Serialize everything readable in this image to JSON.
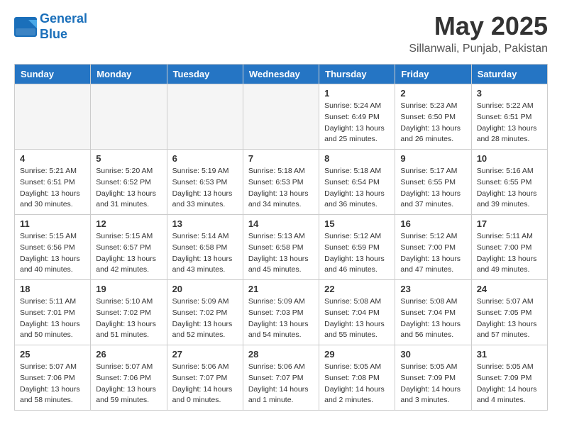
{
  "header": {
    "logo_line1": "General",
    "logo_line2": "Blue",
    "month": "May 2025",
    "location": "Sillanwali, Punjab, Pakistan"
  },
  "days_of_week": [
    "Sunday",
    "Monday",
    "Tuesday",
    "Wednesday",
    "Thursday",
    "Friday",
    "Saturday"
  ],
  "weeks": [
    [
      {
        "day": "",
        "empty": true
      },
      {
        "day": "",
        "empty": true
      },
      {
        "day": "",
        "empty": true
      },
      {
        "day": "",
        "empty": true
      },
      {
        "day": "1",
        "sunrise": "Sunrise: 5:24 AM",
        "sunset": "Sunset: 6:49 PM",
        "daylight": "Daylight: 13 hours and 25 minutes."
      },
      {
        "day": "2",
        "sunrise": "Sunrise: 5:23 AM",
        "sunset": "Sunset: 6:50 PM",
        "daylight": "Daylight: 13 hours and 26 minutes."
      },
      {
        "day": "3",
        "sunrise": "Sunrise: 5:22 AM",
        "sunset": "Sunset: 6:51 PM",
        "daylight": "Daylight: 13 hours and 28 minutes."
      }
    ],
    [
      {
        "day": "4",
        "sunrise": "Sunrise: 5:21 AM",
        "sunset": "Sunset: 6:51 PM",
        "daylight": "Daylight: 13 hours and 30 minutes."
      },
      {
        "day": "5",
        "sunrise": "Sunrise: 5:20 AM",
        "sunset": "Sunset: 6:52 PM",
        "daylight": "Daylight: 13 hours and 31 minutes."
      },
      {
        "day": "6",
        "sunrise": "Sunrise: 5:19 AM",
        "sunset": "Sunset: 6:53 PM",
        "daylight": "Daylight: 13 hours and 33 minutes."
      },
      {
        "day": "7",
        "sunrise": "Sunrise: 5:18 AM",
        "sunset": "Sunset: 6:53 PM",
        "daylight": "Daylight: 13 hours and 34 minutes."
      },
      {
        "day": "8",
        "sunrise": "Sunrise: 5:18 AM",
        "sunset": "Sunset: 6:54 PM",
        "daylight": "Daylight: 13 hours and 36 minutes."
      },
      {
        "day": "9",
        "sunrise": "Sunrise: 5:17 AM",
        "sunset": "Sunset: 6:55 PM",
        "daylight": "Daylight: 13 hours and 37 minutes."
      },
      {
        "day": "10",
        "sunrise": "Sunrise: 5:16 AM",
        "sunset": "Sunset: 6:55 PM",
        "daylight": "Daylight: 13 hours and 39 minutes."
      }
    ],
    [
      {
        "day": "11",
        "sunrise": "Sunrise: 5:15 AM",
        "sunset": "Sunset: 6:56 PM",
        "daylight": "Daylight: 13 hours and 40 minutes."
      },
      {
        "day": "12",
        "sunrise": "Sunrise: 5:15 AM",
        "sunset": "Sunset: 6:57 PM",
        "daylight": "Daylight: 13 hours and 42 minutes."
      },
      {
        "day": "13",
        "sunrise": "Sunrise: 5:14 AM",
        "sunset": "Sunset: 6:58 PM",
        "daylight": "Daylight: 13 hours and 43 minutes."
      },
      {
        "day": "14",
        "sunrise": "Sunrise: 5:13 AM",
        "sunset": "Sunset: 6:58 PM",
        "daylight": "Daylight: 13 hours and 45 minutes."
      },
      {
        "day": "15",
        "sunrise": "Sunrise: 5:12 AM",
        "sunset": "Sunset: 6:59 PM",
        "daylight": "Daylight: 13 hours and 46 minutes."
      },
      {
        "day": "16",
        "sunrise": "Sunrise: 5:12 AM",
        "sunset": "Sunset: 7:00 PM",
        "daylight": "Daylight: 13 hours and 47 minutes."
      },
      {
        "day": "17",
        "sunrise": "Sunrise: 5:11 AM",
        "sunset": "Sunset: 7:00 PM",
        "daylight": "Daylight: 13 hours and 49 minutes."
      }
    ],
    [
      {
        "day": "18",
        "sunrise": "Sunrise: 5:11 AM",
        "sunset": "Sunset: 7:01 PM",
        "daylight": "Daylight: 13 hours and 50 minutes."
      },
      {
        "day": "19",
        "sunrise": "Sunrise: 5:10 AM",
        "sunset": "Sunset: 7:02 PM",
        "daylight": "Daylight: 13 hours and 51 minutes."
      },
      {
        "day": "20",
        "sunrise": "Sunrise: 5:09 AM",
        "sunset": "Sunset: 7:02 PM",
        "daylight": "Daylight: 13 hours and 52 minutes."
      },
      {
        "day": "21",
        "sunrise": "Sunrise: 5:09 AM",
        "sunset": "Sunset: 7:03 PM",
        "daylight": "Daylight: 13 hours and 54 minutes."
      },
      {
        "day": "22",
        "sunrise": "Sunrise: 5:08 AM",
        "sunset": "Sunset: 7:04 PM",
        "daylight": "Daylight: 13 hours and 55 minutes."
      },
      {
        "day": "23",
        "sunrise": "Sunrise: 5:08 AM",
        "sunset": "Sunset: 7:04 PM",
        "daylight": "Daylight: 13 hours and 56 minutes."
      },
      {
        "day": "24",
        "sunrise": "Sunrise: 5:07 AM",
        "sunset": "Sunset: 7:05 PM",
        "daylight": "Daylight: 13 hours and 57 minutes."
      }
    ],
    [
      {
        "day": "25",
        "sunrise": "Sunrise: 5:07 AM",
        "sunset": "Sunset: 7:06 PM",
        "daylight": "Daylight: 13 hours and 58 minutes."
      },
      {
        "day": "26",
        "sunrise": "Sunrise: 5:07 AM",
        "sunset": "Sunset: 7:06 PM",
        "daylight": "Daylight: 13 hours and 59 minutes."
      },
      {
        "day": "27",
        "sunrise": "Sunrise: 5:06 AM",
        "sunset": "Sunset: 7:07 PM",
        "daylight": "Daylight: 14 hours and 0 minutes."
      },
      {
        "day": "28",
        "sunrise": "Sunrise: 5:06 AM",
        "sunset": "Sunset: 7:07 PM",
        "daylight": "Daylight: 14 hours and 1 minute."
      },
      {
        "day": "29",
        "sunrise": "Sunrise: 5:05 AM",
        "sunset": "Sunset: 7:08 PM",
        "daylight": "Daylight: 14 hours and 2 minutes."
      },
      {
        "day": "30",
        "sunrise": "Sunrise: 5:05 AM",
        "sunset": "Sunset: 7:09 PM",
        "daylight": "Daylight: 14 hours and 3 minutes."
      },
      {
        "day": "31",
        "sunrise": "Sunrise: 5:05 AM",
        "sunset": "Sunset: 7:09 PM",
        "daylight": "Daylight: 14 hours and 4 minutes."
      }
    ]
  ]
}
